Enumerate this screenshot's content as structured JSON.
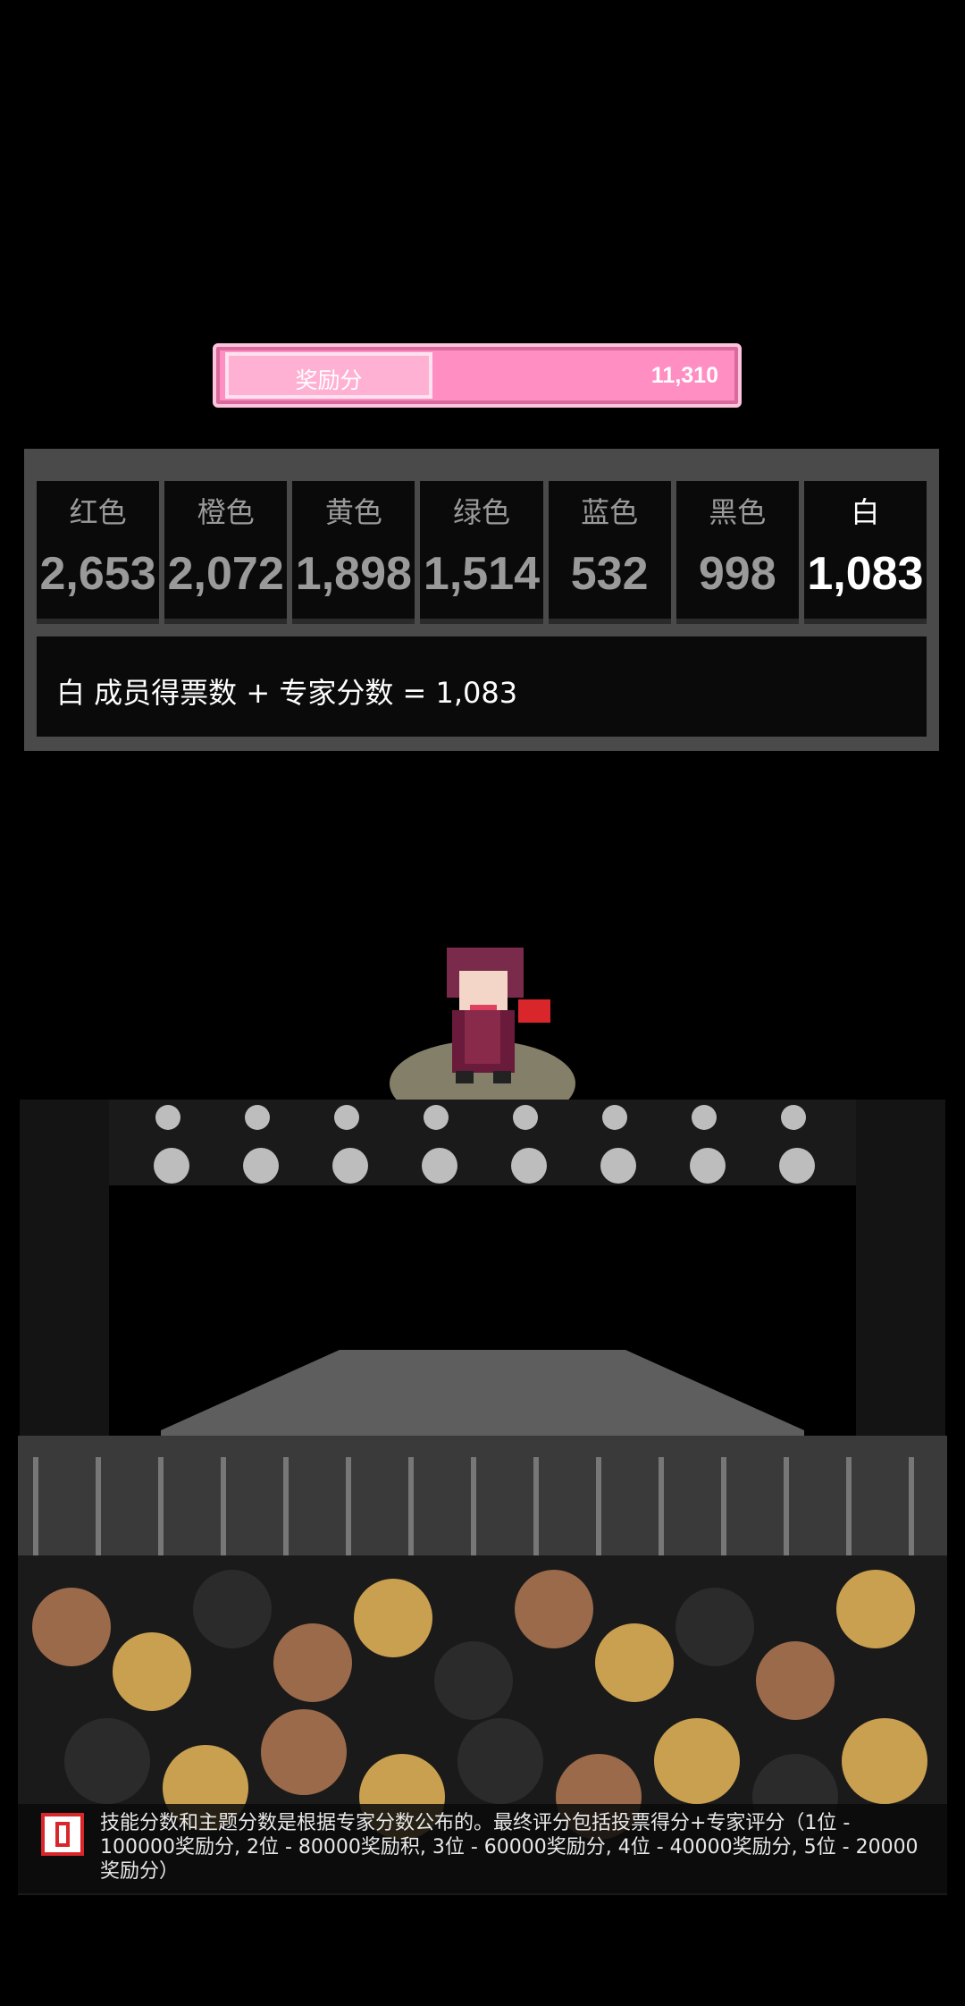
{
  "bonus": {
    "label": "奖励分",
    "value": "11,310"
  },
  "scores": [
    {
      "name": "红色",
      "value": "2,653"
    },
    {
      "name": "橙色",
      "value": "2,072"
    },
    {
      "name": "黄色",
      "value": "1,898"
    },
    {
      "name": "绿色",
      "value": "1,514"
    },
    {
      "name": "蓝色",
      "value": "532"
    },
    {
      "name": "黑色",
      "value": "998"
    },
    {
      "name": "白",
      "value": "1,083"
    }
  ],
  "summary": "白 成员得票数 + 专家分数 = 1,083",
  "tip": {
    "icon": "info-icon",
    "text": "技能分数和主题分数是根据专家分数公布的。最终评分包括投票得分+专家评分（1位 - 100000奖励分, 2位 -  80000奖励积, 3位 -  60000奖励分, 4位 -  40000奖励分, 5位 - 20000奖励分）"
  },
  "colors": {
    "bonus_pink": "#ff8ec2",
    "panel_gray": "#4a4a4a",
    "active_text": "#ffffff",
    "inactive_text": "#9a9a9a"
  }
}
